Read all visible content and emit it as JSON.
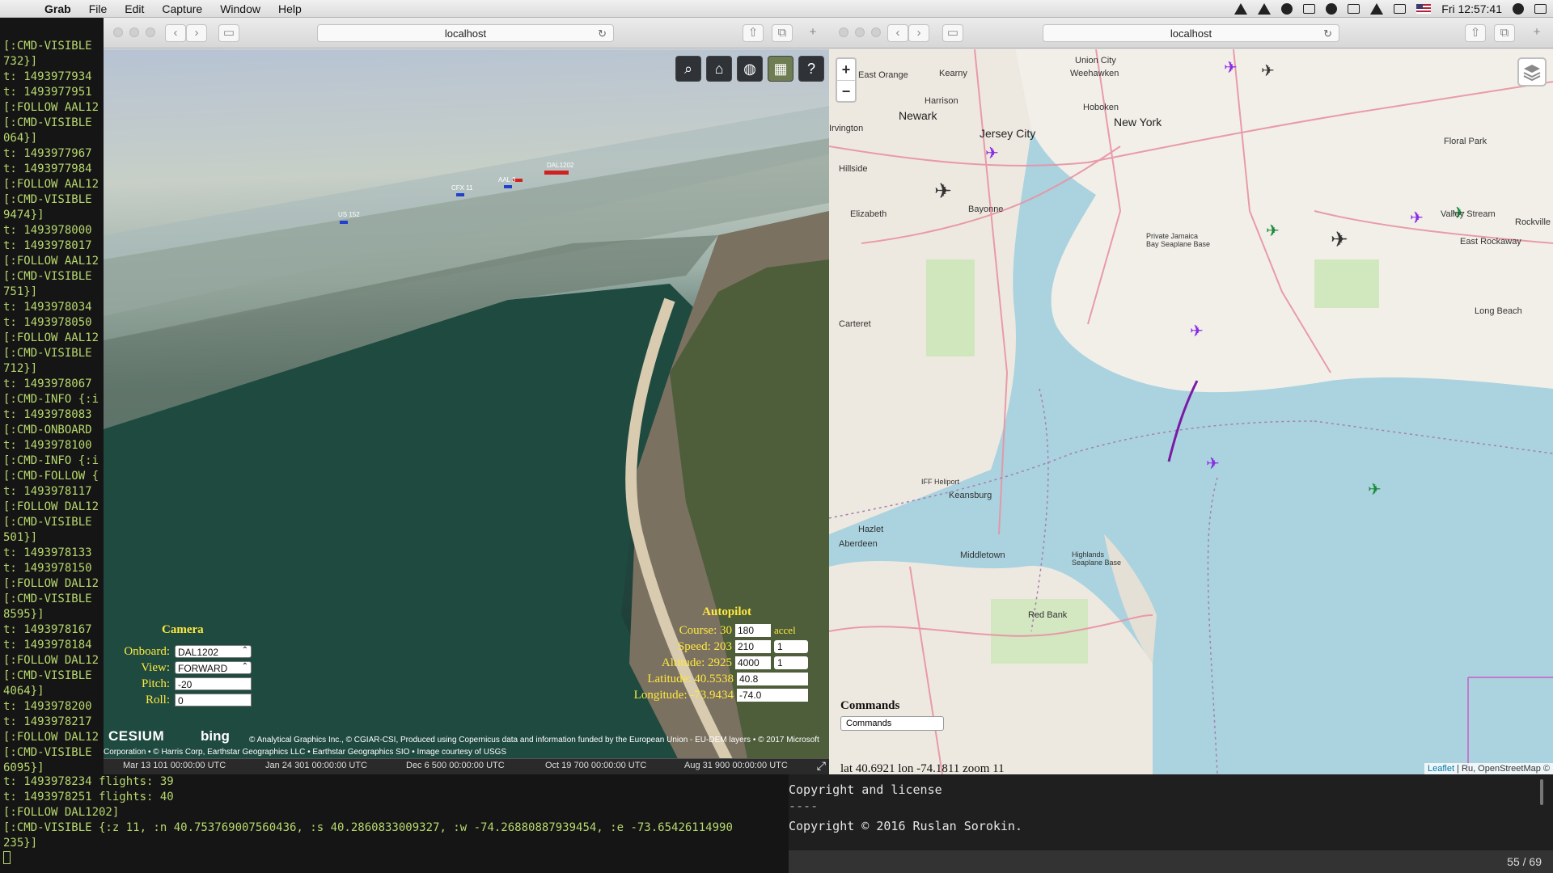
{
  "menubar": {
    "app_name": "Grab",
    "items": [
      "File",
      "Edit",
      "Capture",
      "Window",
      "Help"
    ],
    "clock": "Fri 12:57:41"
  },
  "terminal": {
    "lines": [
      "[:CMD-VISIBLE",
      "732}]",
      "t: 1493977934",
      "t: 1493977951",
      "[:FOLLOW AAL12",
      "[:CMD-VISIBLE",
      "064}]",
      "t: 1493977967",
      "t: 1493977984",
      "[:FOLLOW AAL12",
      "[:CMD-VISIBLE",
      "9474}]",
      "t: 1493978000",
      "t: 1493978017",
      "[:FOLLOW AAL12",
      "[:CMD-VISIBLE",
      "751}]",
      "t: 1493978034",
      "t: 1493978050",
      "[:FOLLOW AAL12",
      "[:CMD-VISIBLE",
      "712}]",
      "t: 1493978067",
      "[:CMD-INFO {:i",
      "t: 1493978083",
      "[:CMD-ONBOARD",
      "t: 1493978100",
      "[:CMD-INFO {:i",
      "[:CMD-FOLLOW {",
      "t: 1493978117",
      "[:FOLLOW DAL12",
      "[:CMD-VISIBLE",
      "501}]",
      "t: 1493978133",
      "t: 1493978150",
      "[:FOLLOW DAL12",
      "[:CMD-VISIBLE",
      "8595}]",
      "t: 1493978167",
      "t: 1493978184",
      "[:FOLLOW DAL12",
      "[:CMD-VISIBLE",
      "4064}]",
      "t: 1493978200",
      "t: 1493978217",
      "[:FOLLOW DAL12",
      "[:CMD-VISIBLE",
      "6095}]"
    ],
    "bottom_lines": [
      "t: 1493978234 flights: 39",
      "t: 1493978251 flights: 40",
      "[:FOLLOW DAL1202]",
      "[:CMD-VISIBLE {:z 11, :n 40.753769007560436, :s 40.2860833009327, :w -74.26880887939454, :e -73.65426114990",
      "235}]"
    ]
  },
  "left_browser": {
    "address": "localhost",
    "camera": {
      "title": "Camera",
      "onboard_label": "Onboard:",
      "onboard_value": "DAL1202",
      "view_label": "View:",
      "view_value": "FORWARD",
      "pitch_label": "Pitch:",
      "pitch_value": "-20",
      "roll_label": "Roll:",
      "roll_value": "0"
    },
    "autopilot": {
      "title": "Autopilot",
      "course_label": "Course: 30",
      "course_value": "180",
      "accel_label": "accel",
      "speed_label": "Speed: 203",
      "speed_value": "210",
      "speed_step": "1",
      "altitude_label": "Altitude: 2925",
      "altitude_value": "4000",
      "altitude_step": "1",
      "latitude_label": "Latitude: 40.5538",
      "latitude_value": "40.8",
      "longitude_label": "Longitude: -73.9434",
      "longitude_value": "-74.0"
    },
    "credits": {
      "cesium": "CESIUM",
      "bing": "bing",
      "text1": "© Analytical Graphics Inc., © CGIAR-CSI, Produced using Copernicus data and information funded by the European Union - EU-DEM layers • © 2017 Microsoft",
      "text2": "Corporation • © Harris Corp, Earthstar Geographics LLC • Earthstar Geographics SIO • Image courtesy of USGS"
    },
    "timeline": [
      "Mar 13 101 00:00:00 UTC",
      "Jan 24 301 00:00:00 UTC",
      "Dec 6 500 00:00:00 UTC",
      "Oct 19 700 00:00:00 UTC",
      "Aug 31 900 00:00:00 UTC"
    ],
    "flight_labels": [
      "US 152",
      "CFX 11",
      "AAL 3",
      "DAL1202"
    ]
  },
  "right_browser": {
    "address": "localhost",
    "zoom_in": "+",
    "zoom_out": "−",
    "places": [
      "East Orange",
      "Kearny",
      "Union City",
      "Weehawken",
      "Harrison",
      "Hoboken",
      "Newark",
      "New York",
      "Jersey City",
      "Irvington",
      "Hillside",
      "Elizabeth",
      "Bayonne",
      "Floral Park",
      "Valley Stream",
      "Rockville",
      "East Rockaway",
      "Long Beach",
      "Carteret",
      "Keansburg",
      "Hazlet",
      "Aberdeen",
      "Middletown",
      "Red Bank",
      "Highlands Seaplane Base",
      "IFF Heliport",
      "Private Jamaica Bay Seaplane Base"
    ],
    "commands_title": "Commands",
    "commands_value": "Commands",
    "coords": "lat 40.6921 lon -74.1811 zoom 11",
    "attrib_leaflet": "Leaflet",
    "attrib_rest": "| Ru, OpenStreetMap ©"
  },
  "preview": {
    "line1": "Copyright and license",
    "line2": "----",
    "line3": "Copyright © 2016 Ruslan Sorokin.",
    "pager": "55 / 69"
  }
}
